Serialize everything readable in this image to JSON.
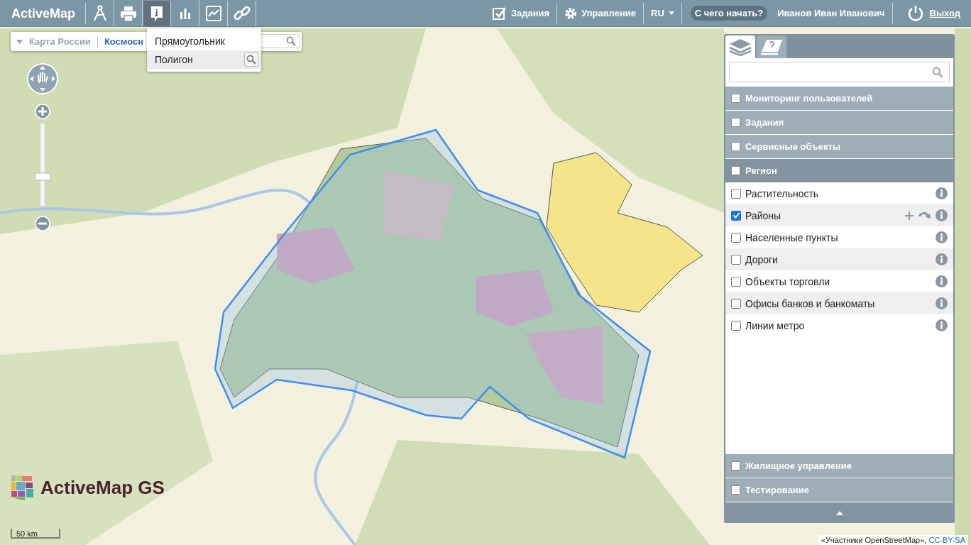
{
  "header": {
    "brand": "ActiveMap",
    "tools": [
      {
        "selected": false
      },
      {
        "selected": false
      },
      {
        "selected": true
      },
      {
        "selected": false
      },
      {
        "selected": false
      },
      {
        "selected": false
      }
    ],
    "tasks": "Задания",
    "manage": "Управление",
    "lang": "RU",
    "help": "С чего начать?",
    "user": "Иванов Иван Иванович",
    "logout": "Выход"
  },
  "select_menu": {
    "items": [
      {
        "label": "Прямоугольник",
        "selected": false
      },
      {
        "label": "Полигон",
        "selected": true
      }
    ]
  },
  "breadcrumb": {
    "items": [
      {
        "label": "Карта России",
        "selected": false
      },
      {
        "label": "Космосн",
        "selected": true
      }
    ]
  },
  "zoom": {
    "level": 0.35
  },
  "layers_panel": {
    "tabs": [
      {
        "selected": true
      },
      {
        "selected": false
      }
    ],
    "groups": [
      {
        "label": "Мониторинг пользователей",
        "checked": false,
        "expanded": false
      },
      {
        "label": "Задания",
        "checked": false,
        "expanded": false
      },
      {
        "label": "Сервисные объекты",
        "checked": false,
        "expanded": false
      },
      {
        "label": "Регион",
        "checked": false,
        "expanded": true,
        "children": [
          {
            "label": "Растительность",
            "checked": false
          },
          {
            "label": "Районы",
            "checked": true
          },
          {
            "label": "Населенные пункты",
            "checked": false
          },
          {
            "label": "Дороги",
            "checked": false
          },
          {
            "label": "Объекты торговли",
            "checked": false
          },
          {
            "label": "Офисы банков и банкоматы",
            "checked": false
          },
          {
            "label": "Линии метро",
            "checked": false
          }
        ]
      },
      {
        "label": "Жилищное управление",
        "checked": false,
        "expanded": false
      },
      {
        "label": "Тестирование",
        "checked": false,
        "expanded": false
      }
    ]
  },
  "logo": "ActiveMap GS",
  "scale": "50 km",
  "attribution": {
    "text": "«Участники OpenStreetMap», ",
    "link": "CC-BY-SA"
  }
}
